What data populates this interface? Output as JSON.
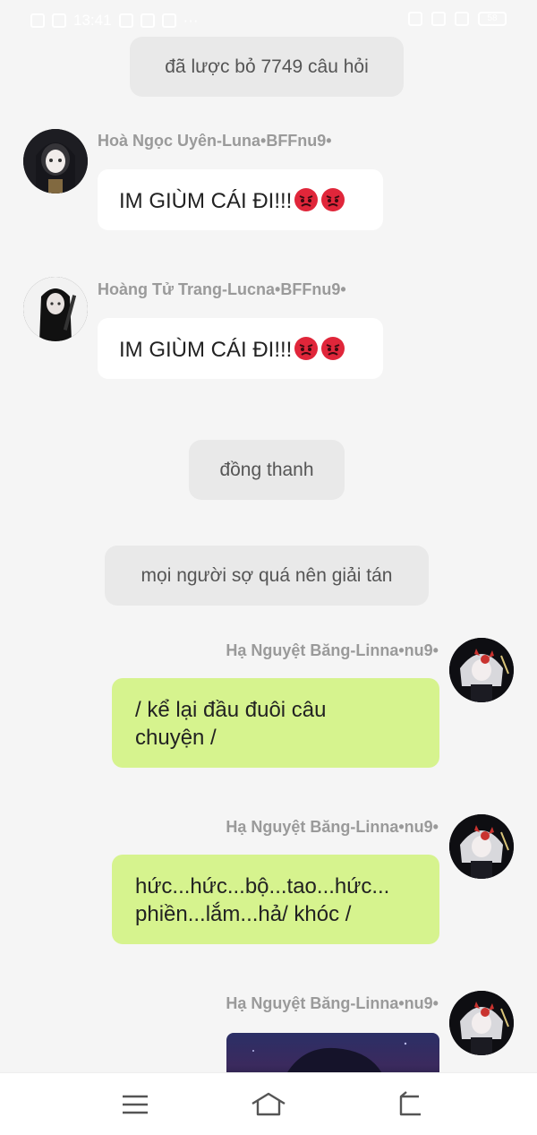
{
  "status_bar": {
    "time": "13:41",
    "battery": "58"
  },
  "system_messages": [
    "đã lược bỏ 7749 câu hỏi",
    "đồng thanh",
    "mọi người sợ quá nên giải tán"
  ],
  "messages": [
    {
      "sender": "Hoà Ngọc Uyên-Luna•BFFnu9•",
      "text": "IM GIÙM CÁI ĐI!!!",
      "emoji": "angry-face x2",
      "side": "left"
    },
    {
      "sender": "Hoàng Tử Trang-Lucna•BFFnu9•",
      "text": "IM GIÙM CÁI ĐI!!!",
      "emoji": "angry-face x2",
      "side": "left"
    },
    {
      "sender": "Hạ Nguyệt Băng-Linna•nu9•",
      "line1": "/ kể lại đầu đuôi câu",
      "line2": "chuyện /",
      "side": "right"
    },
    {
      "sender": "Hạ Nguyệt Băng-Linna•nu9•",
      "line1": "hức...hức...bộ...tao...hức...",
      "line2": "phiền...lắm...hả/ khóc /",
      "side": "right"
    },
    {
      "sender": "Hạ Nguyệt Băng-Linna•nu9•",
      "side": "right",
      "attachment": "image"
    }
  ],
  "colors": {
    "background": "#f5f5f5",
    "outgoing_bubble": "#d6f38e",
    "incoming_bubble": "#ffffff",
    "system_pill": "#e9e9e9"
  },
  "nav": {
    "icons": [
      "menu-icon",
      "home-icon",
      "back-icon"
    ]
  }
}
